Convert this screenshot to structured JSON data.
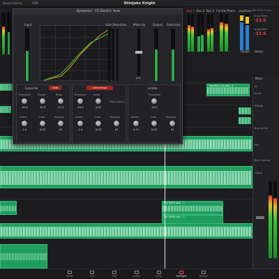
{
  "topbar": {
    "sound_library": "Sound Library",
    "adr": "ADR",
    "project_title": "Shinjuku Knight"
  },
  "dialog": {
    "title": "Dynamics - FX Electric Hum",
    "input_label": "Input",
    "gain_reduction_label": "Gain Reduction",
    "makeup_label": "Make Up",
    "output_label": "Output",
    "sidechain_label": "Sidechain",
    "makeup_value": "0.0",
    "expander": {
      "title": "Expander",
      "gate_label": "Gate",
      "col1": "Threshold",
      "col2": "Range",
      "col3": "Ratio",
      "v1": "-31.0",
      "v2": "20.0",
      "v3": "1:1.1",
      "col4": "Attack",
      "col5": "Hold",
      "col6": "Release",
      "v4": "1.4",
      "v5": "0.00",
      "v6": "93"
    },
    "compressor": {
      "title": "Compressor",
      "enable_label": "Compressor",
      "col1": "Threshold",
      "col2": "Ratio",
      "col3": "Send Colors",
      "v1": "-10.0",
      "v2": "2.01",
      "col4": "Attack",
      "col5": "Hold",
      "col6": "Release",
      "v4": "1.4",
      "v5": "0.00",
      "v6": "93"
    },
    "limiter": {
      "title": "Limiter",
      "col1": "Threshold",
      "v1": "-10.0",
      "col4": "Attack",
      "col5": "Hold",
      "col6": "Release",
      "v4": "0.71",
      "v5": "0.00",
      "v6": "91"
    }
  },
  "monitor": {
    "bus1": "Bus 1",
    "bus2": "Bus 2",
    "bus3": "Bus 3",
    "control_room": "Control Room",
    "loudness": "Loudness",
    "loudness_std": "BS.1770-1 (LU)",
    "short_term": "Short Term",
    "short_val": "-13.6",
    "integrated": "Integrated",
    "integrated_val": "-13.6",
    "pause": "Pause",
    "reset": "Reset"
  },
  "timeline": {
    "clip_labels": [
      "Transform A1.wav - L",
      "Nw Traffic.wav - L",
      "Nw Traffic.wav - L"
    ]
  },
  "mixer": {
    "title": "Mixer",
    "rows": [
      "A1",
      "Input",
      "Effects",
      "Bus Sends",
      "Pan",
      "Bus Outputs",
      "Group"
    ]
  },
  "nav": {
    "items": [
      "Media",
      "Cut",
      "Edit",
      "Fusion",
      "Color",
      "Fairlight",
      "Deliver"
    ],
    "active": "Fairlight"
  }
}
